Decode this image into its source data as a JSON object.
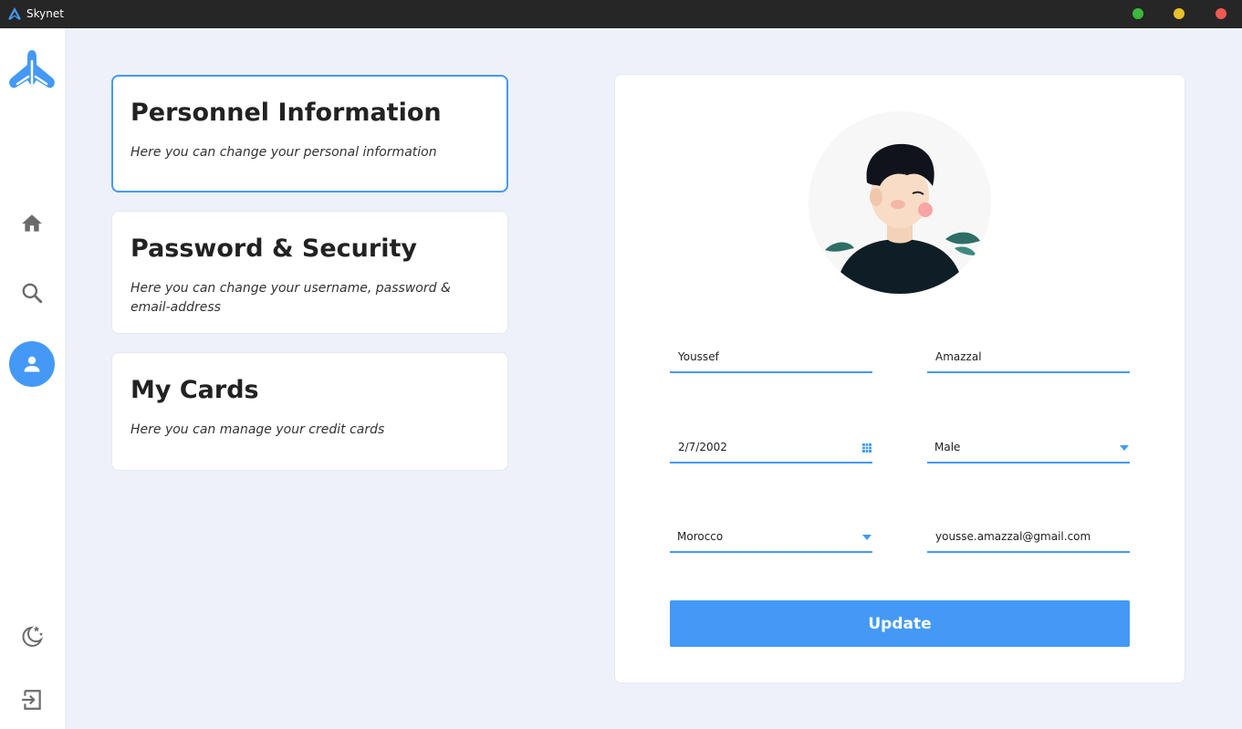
{
  "window": {
    "title": "Skynet",
    "controls": {
      "green": "#3cb83c",
      "yellow": "#e8c02c",
      "red": "#f05a4f"
    }
  },
  "colors": {
    "accent": "#4499f7",
    "background": "#eef1f9",
    "panel": "#ffffff",
    "titlebar": "#262626"
  },
  "sidebar": {
    "logo": "skynet-logo",
    "items": [
      {
        "name": "home",
        "icon": "home-icon",
        "active": false
      },
      {
        "name": "search",
        "icon": "search-icon",
        "active": false
      },
      {
        "name": "profile",
        "icon": "user-icon",
        "active": true
      }
    ],
    "bottom": [
      {
        "name": "theme",
        "icon": "moon-stars-icon"
      },
      {
        "name": "logout",
        "icon": "logout-icon"
      }
    ]
  },
  "settings_menu": [
    {
      "title": "Personnel Information",
      "description": "Here you can change your personal information",
      "active": true
    },
    {
      "title": "Password & Security",
      "description": "Here you can change your username, password & email-address",
      "active": false
    },
    {
      "title": "My Cards",
      "description": "Here you can manage your credit cards",
      "active": false
    }
  ],
  "profile_form": {
    "avatar": "user-avatar-illustration",
    "first_name": "Youssef",
    "last_name": "Amazzal",
    "birth_date": "2/7/2002",
    "gender": "Male",
    "country": "Morocco",
    "email": "yousse.amazzal@gmail.com",
    "update_label": "Update"
  }
}
